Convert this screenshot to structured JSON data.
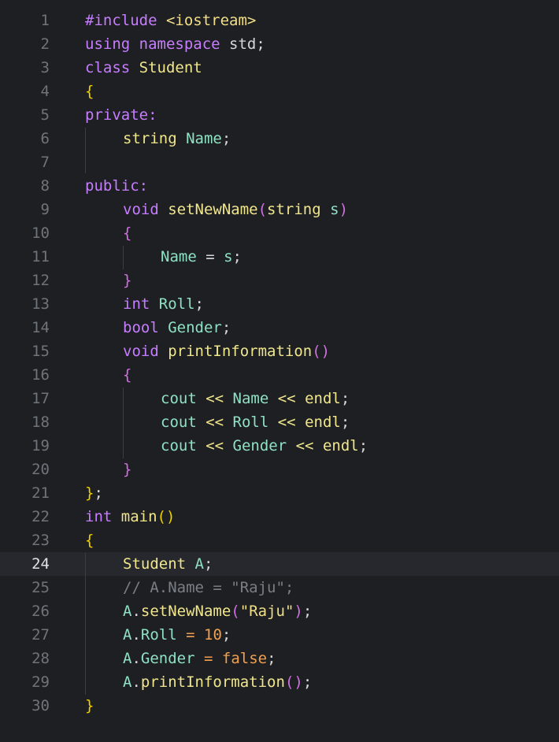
{
  "editor": {
    "current_line": 24,
    "colors": {
      "background": "#1e1f22",
      "current_line": "#26282e",
      "gutter": "#6f737a",
      "keyword": "#c77dff",
      "type": "#f0e68c",
      "identifier": "#8fe1c3",
      "string": "#f2df88",
      "comment": "#7a7e85",
      "number": "#f0a050",
      "punct": "#d7d7d7"
    },
    "lines": [
      {
        "num": "1",
        "indent": 0,
        "tokens": [
          {
            "t": "#include ",
            "c": "kw"
          },
          {
            "t": "<iostream>",
            "c": "str"
          }
        ]
      },
      {
        "num": "2",
        "indent": 0,
        "tokens": [
          {
            "t": "using ",
            "c": "kw"
          },
          {
            "t": "namespace ",
            "c": "kw"
          },
          {
            "t": "std",
            "c": "p"
          },
          {
            "t": ";",
            "c": "p"
          }
        ]
      },
      {
        "num": "3",
        "indent": 0,
        "tokens": [
          {
            "t": "class ",
            "c": "kw"
          },
          {
            "t": "Student",
            "c": "ty"
          }
        ]
      },
      {
        "num": "4",
        "indent": 0,
        "tokens": [
          {
            "t": "{",
            "c": "br"
          }
        ]
      },
      {
        "num": "5",
        "indent": 0,
        "tokens": [
          {
            "t": "private:",
            "c": "kw"
          }
        ]
      },
      {
        "num": "6",
        "indent": 1,
        "tokens": [
          {
            "t": "string ",
            "c": "ty"
          },
          {
            "t": "Name",
            "c": "id"
          },
          {
            "t": ";",
            "c": "p"
          }
        ]
      },
      {
        "num": "7",
        "indent": 0,
        "tokens": []
      },
      {
        "num": "8",
        "indent": 0,
        "tokens": [
          {
            "t": "public:",
            "c": "kw"
          }
        ]
      },
      {
        "num": "9",
        "indent": 1,
        "tokens": [
          {
            "t": "void ",
            "c": "kw"
          },
          {
            "t": "setNewName",
            "c": "ty"
          },
          {
            "t": "(",
            "c": "br2"
          },
          {
            "t": "string ",
            "c": "ty"
          },
          {
            "t": "s",
            "c": "id"
          },
          {
            "t": ")",
            "c": "br2"
          }
        ]
      },
      {
        "num": "10",
        "indent": 1,
        "tokens": [
          {
            "t": "{",
            "c": "br2"
          }
        ]
      },
      {
        "num": "11",
        "indent": 2,
        "tokens": [
          {
            "t": "Name ",
            "c": "id"
          },
          {
            "t": "= ",
            "c": "p"
          },
          {
            "t": "s",
            "c": "id"
          },
          {
            "t": ";",
            "c": "p"
          }
        ]
      },
      {
        "num": "12",
        "indent": 1,
        "tokens": [
          {
            "t": "}",
            "c": "br2"
          }
        ]
      },
      {
        "num": "13",
        "indent": 1,
        "tokens": [
          {
            "t": "int ",
            "c": "kw"
          },
          {
            "t": "Roll",
            "c": "id"
          },
          {
            "t": ";",
            "c": "p"
          }
        ]
      },
      {
        "num": "14",
        "indent": 1,
        "tokens": [
          {
            "t": "bool ",
            "c": "kw"
          },
          {
            "t": "Gender",
            "c": "id"
          },
          {
            "t": ";",
            "c": "p"
          }
        ]
      },
      {
        "num": "15",
        "indent": 1,
        "tokens": [
          {
            "t": "void ",
            "c": "kw"
          },
          {
            "t": "printInformation",
            "c": "ty"
          },
          {
            "t": "()",
            "c": "br2"
          }
        ]
      },
      {
        "num": "16",
        "indent": 1,
        "tokens": [
          {
            "t": "{",
            "c": "br2"
          }
        ]
      },
      {
        "num": "17",
        "indent": 2,
        "tokens": [
          {
            "t": "cout ",
            "c": "id"
          },
          {
            "t": "<< ",
            "c": "ty"
          },
          {
            "t": "Name ",
            "c": "id"
          },
          {
            "t": "<< ",
            "c": "ty"
          },
          {
            "t": "endl",
            "c": "ty"
          },
          {
            "t": ";",
            "c": "p"
          }
        ]
      },
      {
        "num": "18",
        "indent": 2,
        "tokens": [
          {
            "t": "cout ",
            "c": "id"
          },
          {
            "t": "<< ",
            "c": "ty"
          },
          {
            "t": "Roll ",
            "c": "id"
          },
          {
            "t": "<< ",
            "c": "ty"
          },
          {
            "t": "endl",
            "c": "ty"
          },
          {
            "t": ";",
            "c": "p"
          }
        ]
      },
      {
        "num": "19",
        "indent": 2,
        "tokens": [
          {
            "t": "cout ",
            "c": "id"
          },
          {
            "t": "<< ",
            "c": "ty"
          },
          {
            "t": "Gender ",
            "c": "id"
          },
          {
            "t": "<< ",
            "c": "ty"
          },
          {
            "t": "endl",
            "c": "ty"
          },
          {
            "t": ";",
            "c": "p"
          }
        ]
      },
      {
        "num": "20",
        "indent": 1,
        "tokens": [
          {
            "t": "}",
            "c": "br2"
          }
        ]
      },
      {
        "num": "21",
        "indent": 0,
        "tokens": [
          {
            "t": "}",
            "c": "br"
          },
          {
            "t": ";",
            "c": "p"
          }
        ]
      },
      {
        "num": "22",
        "indent": 0,
        "tokens": [
          {
            "t": "int ",
            "c": "kw"
          },
          {
            "t": "main",
            "c": "ty"
          },
          {
            "t": "()",
            "c": "br"
          }
        ]
      },
      {
        "num": "23",
        "indent": 0,
        "tokens": [
          {
            "t": "{",
            "c": "br"
          }
        ]
      },
      {
        "num": "24",
        "indent": 1,
        "tokens": [
          {
            "t": "Student ",
            "c": "ty"
          },
          {
            "t": "A",
            "c": "id"
          },
          {
            "t": ";",
            "c": "p"
          }
        ]
      },
      {
        "num": "25",
        "indent": 1,
        "tokens": [
          {
            "t": "// A.Name = \"Raju\";",
            "c": "cm"
          }
        ]
      },
      {
        "num": "26",
        "indent": 1,
        "tokens": [
          {
            "t": "A",
            "c": "id"
          },
          {
            "t": ".",
            "c": "p"
          },
          {
            "t": "setNewName",
            "c": "ty"
          },
          {
            "t": "(",
            "c": "br2"
          },
          {
            "t": "\"Raju\"",
            "c": "str"
          },
          {
            "t": ")",
            "c": "br2"
          },
          {
            "t": ";",
            "c": "p"
          }
        ]
      },
      {
        "num": "27",
        "indent": 1,
        "tokens": [
          {
            "t": "A",
            "c": "id"
          },
          {
            "t": ".",
            "c": "p"
          },
          {
            "t": "Roll ",
            "c": "id"
          },
          {
            "t": "= ",
            "c": "nm"
          },
          {
            "t": "10",
            "c": "nm"
          },
          {
            "t": ";",
            "c": "p"
          }
        ]
      },
      {
        "num": "28",
        "indent": 1,
        "tokens": [
          {
            "t": "A",
            "c": "id"
          },
          {
            "t": ".",
            "c": "p"
          },
          {
            "t": "Gender ",
            "c": "id"
          },
          {
            "t": "= ",
            "c": "nm"
          },
          {
            "t": "false",
            "c": "nm"
          },
          {
            "t": ";",
            "c": "p"
          }
        ]
      },
      {
        "num": "29",
        "indent": 1,
        "tokens": [
          {
            "t": "A",
            "c": "id"
          },
          {
            "t": ".",
            "c": "p"
          },
          {
            "t": "printInformation",
            "c": "ty"
          },
          {
            "t": "()",
            "c": "br2"
          },
          {
            "t": ";",
            "c": "p"
          }
        ]
      },
      {
        "num": "30",
        "indent": 0,
        "tokens": [
          {
            "t": "}",
            "c": "br"
          }
        ]
      }
    ]
  }
}
